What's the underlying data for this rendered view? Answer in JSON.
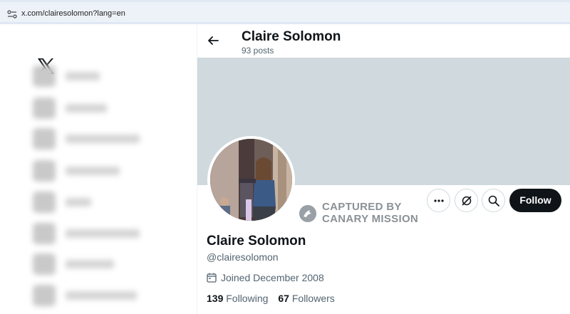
{
  "browser": {
    "url": "x.com/clairesolomon?lang=en"
  },
  "nav": {
    "logo_icon": "x-logo-icon",
    "items_blurred": 8
  },
  "header": {
    "name": "Claire Solomon",
    "posts": "93 posts"
  },
  "watermark": {
    "line1": "CAPTURED BY",
    "line2": "CANARY MISSION"
  },
  "actions": {
    "more_icon": "more-icon",
    "grok_icon": "grok-icon",
    "search_icon": "search-icon",
    "follow_label": "Follow"
  },
  "profile": {
    "name": "Claire Solomon",
    "handle": "@clairesolomon",
    "joined": "Joined December 2008",
    "following_count": "139",
    "following_label": "Following",
    "followers_count": "67",
    "followers_label": "Followers"
  },
  "colors": {
    "banner": "#cfd9de",
    "follow_bg": "#0f1419",
    "secondary_text": "#536471"
  }
}
